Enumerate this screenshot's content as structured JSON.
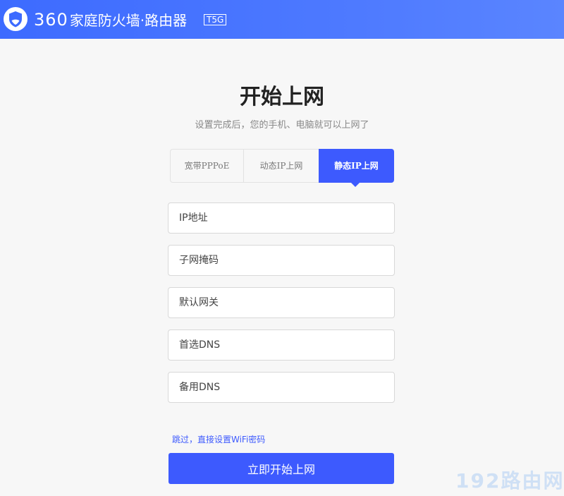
{
  "header": {
    "brand_num": "360",
    "brand_text": "家庭防火墙·路由器",
    "model": "T5G",
    "logo_icon": "shield-icon",
    "gradient_start": "#3d6bff",
    "gradient_end": "#5a85ff"
  },
  "page": {
    "title": "开始上网",
    "subtitle": "设置完成后，您的手机、电脑就可以上网了"
  },
  "tabs": [
    {
      "label": "宽带PPPoE",
      "active": false
    },
    {
      "label": "动态IP上网",
      "active": false
    },
    {
      "label": "静态IP上网",
      "active": true
    }
  ],
  "form": {
    "ip_placeholder": "IP地址",
    "mask_placeholder": "子网掩码",
    "gateway_placeholder": "默认网关",
    "dns1_placeholder": "首选DNS",
    "dns2_placeholder": "备用DNS"
  },
  "skip_link": "跳过，直接设置WiFi密码",
  "submit_label": "立即开始上网",
  "watermark": "192路由网",
  "colors": {
    "accent": "#3d5afe",
    "background": "#f7f7f7"
  }
}
